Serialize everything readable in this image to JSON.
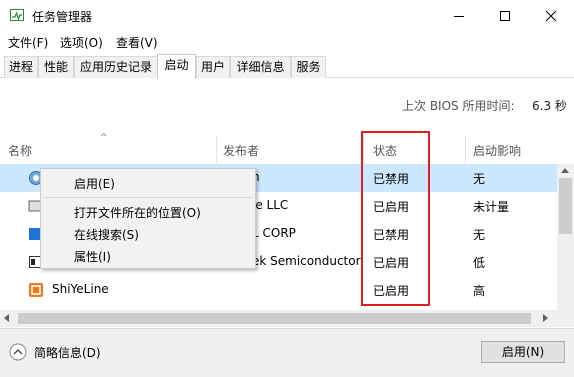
{
  "window": {
    "title": "任务管理器",
    "icon": "task-manager-icon",
    "controls": [
      "minimize-icon",
      "maximize-icon",
      "close-icon"
    ]
  },
  "menu": [
    "文件(F)",
    "选项(O)",
    "查看(V)"
  ],
  "tabs": [
    "进程",
    "性能",
    "应用历史记录",
    "启动",
    "用户",
    "详细信息",
    "服务"
  ],
  "active_tab": "启动",
  "bios": {
    "label": "上次 BIOS 所用时间:",
    "value": "6.3 秒"
  },
  "columns": [
    "名称",
    "发布者",
    "状态",
    "启动影响"
  ],
  "rows": [
    {
      "name": "",
      "publisher": "n",
      "status": "已禁用",
      "impact": "无",
      "icon": "app-icon",
      "selected": true
    },
    {
      "name": "",
      "publisher": "le LLC",
      "status": "已启用",
      "impact": "未计量",
      "icon": "app-icon"
    },
    {
      "name": "",
      "publisher": "L CORP",
      "status": "已禁用",
      "impact": "无",
      "icon": "app-icon"
    },
    {
      "name": "",
      "publisher": "ek Semiconductor",
      "status": "已启用",
      "impact": "低",
      "icon": "app-icon"
    },
    {
      "name": "ShiYeLine",
      "publisher": "",
      "status": "已启用",
      "impact": "高",
      "icon": "shiyeline-icon"
    }
  ],
  "context_menu": [
    "启用(E)",
    "打开文件所在的位置(O)",
    "在线搜索(S)",
    "属性(I)"
  ],
  "footer": {
    "details": "简略信息(D)",
    "enable_button": "启用(N)"
  },
  "colors": {
    "selection": "#cce8ff",
    "highlight_box": "#e02020",
    "shiyeline_icon": "#f07a20"
  }
}
